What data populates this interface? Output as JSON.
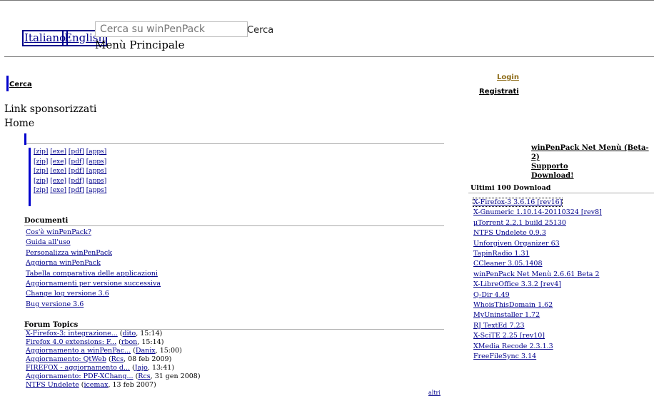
{
  "header": {
    "languages": [
      "Italiano",
      "English"
    ],
    "search_placeholder": "Cerca su winPenPack",
    "search_button": "Cerca",
    "menu_title": "Menù Principale"
  },
  "left": {
    "cerca_label": "Cerca",
    "sponsored": "Link sponsorizzati",
    "home": "Home"
  },
  "account": {
    "login": "Login",
    "register": "Registrati"
  },
  "formats": [
    "[zip]",
    "[exe]",
    "[pdf]",
    "[apps]"
  ],
  "documents": {
    "title": "Documenti",
    "items": [
      "Cos'è winPenPack?",
      "Guida all'uso",
      "Personalizza winPenPack",
      "Aggiorna winPenPack",
      "Tabella comparativa delle applicazioni",
      "Aggiornamenti per versione successiva",
      "Change log versione 3.6",
      "Bug versione 3.6"
    ]
  },
  "forum": {
    "title": "Forum Topics",
    "items": [
      {
        "topic": "X-Firefox-3: integrazione...",
        "user": "dito",
        "time": "15:14"
      },
      {
        "topic": "Firefox 4.0 extensions: F...",
        "user": "rbon",
        "time": "15:14"
      },
      {
        "topic": "Aggiornamento a winPenPac...",
        "user": "Danix",
        "time": "15:00"
      },
      {
        "topic": "Aggiornamento: QtWeb",
        "user": "Rcs",
        "time": "08 feb 2009"
      },
      {
        "topic": "FIREFOX - aggiornamento d...",
        "user": "Jajo",
        "time": "13:41"
      },
      {
        "topic": "Aggiornamento: PDF-XChang...",
        "user": "Rcs",
        "time": "31 gen 2008"
      },
      {
        "topic": "NTFS Undelete",
        "user": "icemax",
        "time": "13 feb 2007"
      }
    ],
    "more": "altri"
  },
  "netmenu": {
    "links": [
      "winPenPack Net Menù (Beta-2)",
      "Supporto",
      "Download!"
    ]
  },
  "downloads": {
    "title": "Ultimi 100 Download",
    "items": [
      "X-Firefox-3 3.6.16 [rev16]",
      "X-Gnumeric 1.10.14-20110324 [rev8]",
      "µTorrent 2.2.1 build 25130",
      "NTFS Undelete 0.9.3",
      "Unforgiven Organizer 63",
      "TapinRadio 1.31",
      "CCleaner 3.05.1408",
      "winPenPack Net Menù 2.6.61 Beta 2",
      "X-LibreOffice 3.3.2 [rev4]",
      "Q-Dir 4.49",
      "WhoisThisDomain 1.62",
      "MyUninstaller 1.72",
      "RJ TextEd 7.23",
      "X-SciTE 2.25 [rev10]",
      "XMedia Recode 2.3.1.3",
      "FreeFileSync 3.14"
    ]
  }
}
